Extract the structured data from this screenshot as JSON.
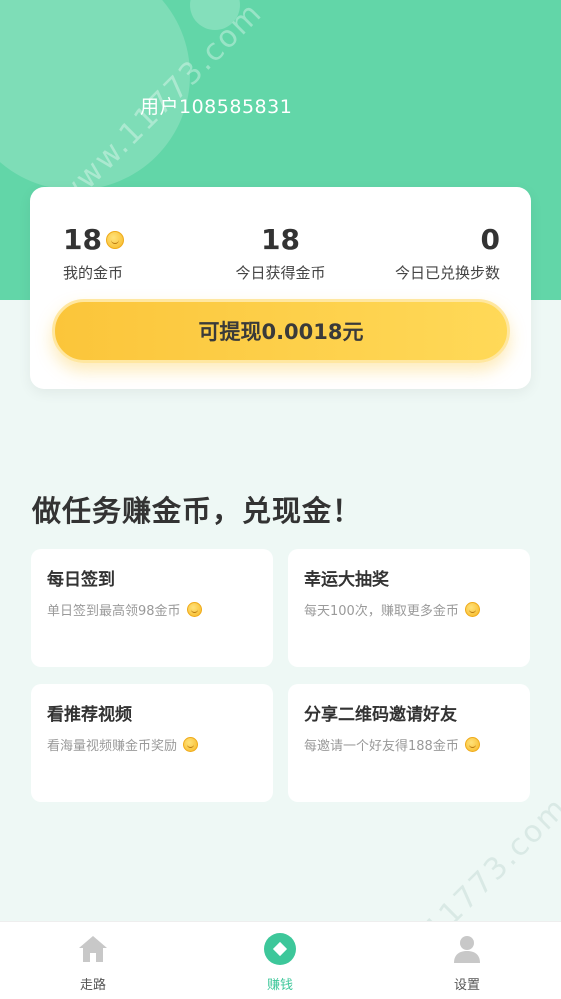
{
  "header": {
    "username": "用户108585831"
  },
  "stats": {
    "my_coins_value": "18",
    "my_coins_label": "我的金币",
    "today_coins_value": "18",
    "today_coins_label": "今日获得金币",
    "today_steps_value": "0",
    "today_steps_label": "今日已兑换步数",
    "withdraw_label": "可提现0.0018元"
  },
  "section": {
    "title": "做任务赚金币，兑现金！"
  },
  "tasks": [
    {
      "title": "每日签到",
      "desc": "单日签到最高领98金币"
    },
    {
      "title": "幸运大抽奖",
      "desc": "每天100次，赚取更多金币"
    },
    {
      "title": "看推荐视频",
      "desc": "看海量视频赚金币奖励"
    },
    {
      "title": "分享二维码邀请好友",
      "desc": "每邀请一个好友得188金币"
    }
  ],
  "tabbar": {
    "items": [
      {
        "label": "走路",
        "icon": "home-icon"
      },
      {
        "label": "赚钱",
        "icon": "coin-diamond-icon"
      },
      {
        "label": "设置",
        "icon": "user-icon"
      }
    ]
  },
  "watermark": "www.11773.com",
  "colors": {
    "brand_green": "#62d6a8",
    "active_tab": "#3dc79a",
    "button_yellow": "#fbc53a"
  }
}
